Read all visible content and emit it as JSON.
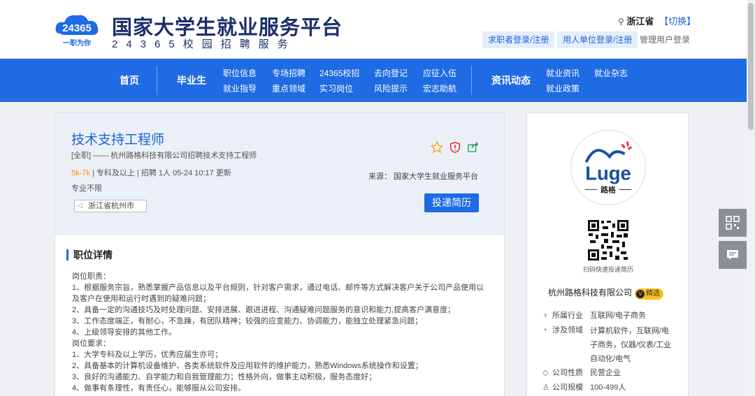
{
  "brand": {
    "title": "国家大学生就业服务平台",
    "subtitle": "24365校园招聘服务",
    "logo_text_top": "24365",
    "logo_text_bottom": "一职为你"
  },
  "region": {
    "name": "浙江省",
    "switch": "【切换】"
  },
  "auth": {
    "seeker": "求职者登录/注册",
    "employer": "用人单位登录/注册",
    "admin": "管理用户登录"
  },
  "nav": {
    "home": "首页",
    "graduates": "毕业生",
    "news": "资讯动态",
    "col1": [
      "职位信息",
      "就业指导"
    ],
    "col2": [
      "专场招聘",
      "重点领域"
    ],
    "col3": [
      "24365校招",
      "实习岗位"
    ],
    "col4": [
      "去向登记",
      "风险提示"
    ],
    "col5": [
      "应征入伍",
      "宏志助航"
    ],
    "col6": [
      "就业资讯",
      "就业政策"
    ],
    "col7": [
      "就业杂志"
    ]
  },
  "job": {
    "title": "技术支持工程师",
    "meta": "[全职]  ——  杭州路格科技有限公司招聘技术支持工程师",
    "salary": "5k-7k",
    "info": "  |  专科及以上  |  招聘 1人  05-24 10:17 更新",
    "major": "专业不限",
    "location": "浙江省杭州市",
    "source": "来源：  国家大学生就业服务平台",
    "apply": "投递简历",
    "icons": [
      "star-icon",
      "report-shield-icon",
      "share-icon"
    ]
  },
  "detail": {
    "heading": "职位详情",
    "lines": [
      "岗位职责：",
      "1、根据服务宗旨，熟悉掌握产品信息以及平台规则，针对客户需求，通过电话、邮件等方式解决客户关于公司产品使用以及客户在使用和运行时遇到的疑难问题；",
      "2、具备一定的沟通技巧及时处理问题、安排进展、跟进进程、沟通疑难问题服务的意识和能力,提高客户满意度；",
      "3、工作态度端正，有耐心，不急躁，有团队精神；较强的应变能力、协调能力，能独立处理紧急问题；",
      "4、上级领导安排的其他工作。",
      "岗位要求：",
      "1、大学专科及以上学历，优秀应届生亦可；",
      "2、具备基本的计算机设备维护、各类系统软件及应用软件的维护能力，熟悉Windows系统操作和设置；",
      "3、良好的沟通能力、自学能力和自我管理能力；性格外向，做事主动积极，服务态度好；",
      "4、做事有条理性，有责任心，能够服从公司安排。"
    ]
  },
  "company": {
    "logo_text": "Luge",
    "logo_sub": "路格",
    "qr_caption": "扫码快速投递简历",
    "name": "杭州路格科技有限公司",
    "badge": "精选",
    "badge_mark": "V",
    "industry_label": "所属行业",
    "industry": "互联网/电子商务",
    "field_label": "涉及领域",
    "field": [
      "计算机软件，互联网/电",
      "子商务，仪器/仪表/工业",
      "自动化/电气"
    ],
    "nature_label": "公司性质",
    "nature": "民营企业",
    "size_label": "公司规模",
    "size": "100-499人"
  },
  "colors": {
    "primary": "#1e6be3",
    "brand_dark": "#1a2f6b",
    "salary": "#ff8a00",
    "badge": "#f8c21e"
  }
}
